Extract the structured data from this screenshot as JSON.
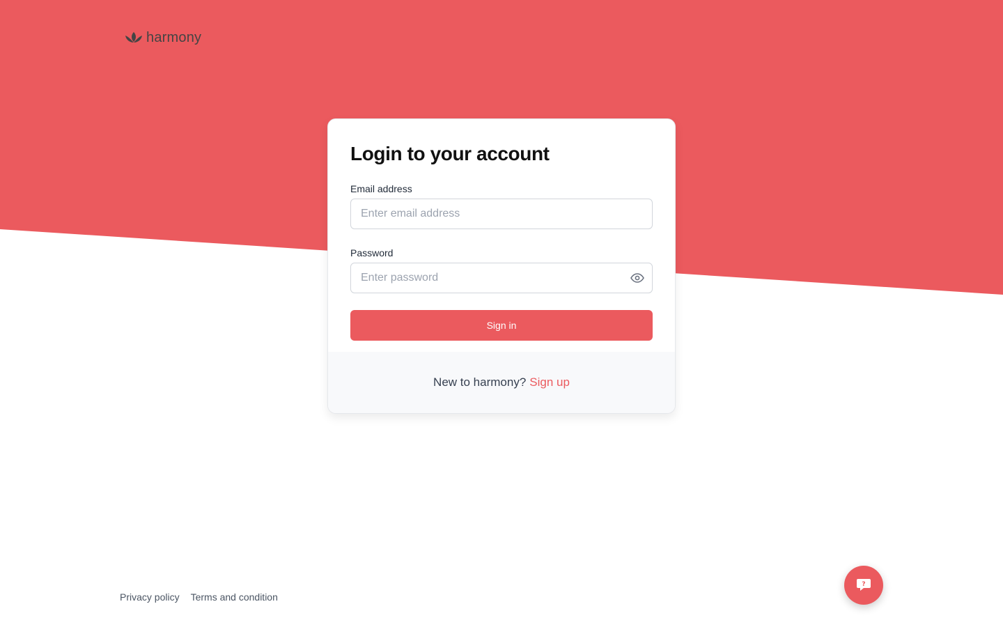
{
  "brand": {
    "name": "harmony",
    "logo_icon": "lotus-icon"
  },
  "colors": {
    "accent": "#eb5a5e",
    "background": "#ffffff",
    "footer_bg": "#f8f9fb"
  },
  "login": {
    "title": "Login to your account",
    "email": {
      "label": "Email address",
      "placeholder": "Enter email address",
      "value": ""
    },
    "password": {
      "label": "Password",
      "placeholder": "Enter password",
      "value": "",
      "toggle_icon": "eye-icon"
    },
    "submit_label": "Sign in"
  },
  "signup": {
    "prompt": "New to harmony?",
    "link_label": "Sign up"
  },
  "footer": {
    "links": [
      "Privacy policy",
      "Terms and condition"
    ]
  },
  "help": {
    "icon": "chat-question-icon"
  }
}
